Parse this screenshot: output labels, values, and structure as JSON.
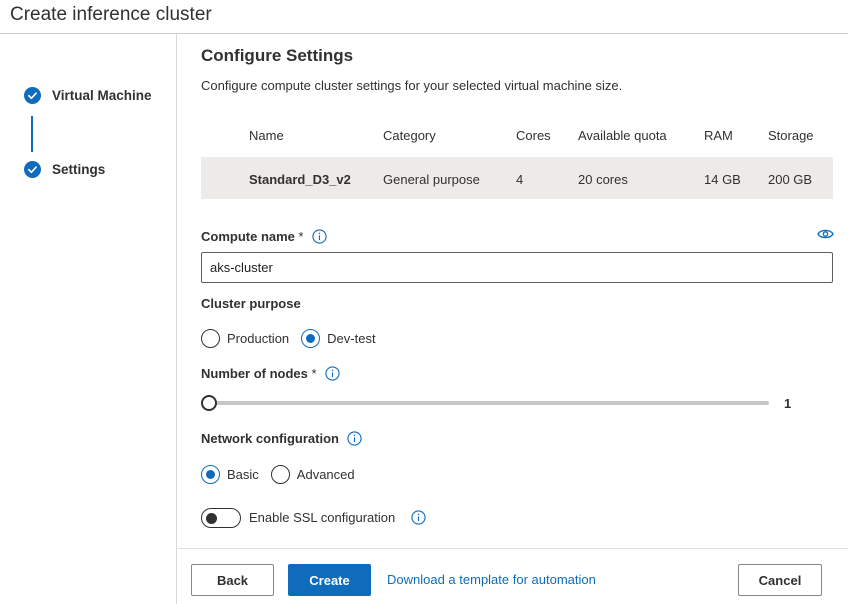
{
  "window": {
    "title": "Create inference cluster"
  },
  "steps": [
    {
      "label": "Virtual Machine",
      "icon": "check-circle-icon",
      "completed": true
    },
    {
      "label": "Settings",
      "icon": "check-circle-icon",
      "completed": true
    }
  ],
  "main": {
    "heading": "Configure Settings",
    "description": "Configure compute cluster settings for your selected virtual machine size."
  },
  "vm_table": {
    "columns": [
      "Name",
      "Category",
      "Cores",
      "Available quota",
      "RAM",
      "Storage"
    ],
    "row": [
      "Standard_D3_v2",
      "General purpose",
      "4",
      "20 cores",
      "14 GB",
      "200 GB"
    ]
  },
  "compute_name": {
    "label": "Compute name",
    "required_marker": "*",
    "value": "aks-cluster",
    "info_icon": "info-icon",
    "eye_icon": "eye-icon"
  },
  "cluster_purpose": {
    "label": "Cluster purpose",
    "options": [
      "Production",
      "Dev-test"
    ],
    "selected": "Dev-test"
  },
  "nodes": {
    "label": "Number of nodes",
    "required_marker": "*",
    "value": "1"
  },
  "network": {
    "label": "Network configuration",
    "options": [
      "Basic",
      "Advanced"
    ],
    "selected": "Basic"
  },
  "ssl": {
    "label": "Enable SSL configuration",
    "enabled": false
  },
  "footer": {
    "back_label": "Back",
    "create_label": "Create",
    "template_link": "Download a template for automation",
    "cancel_label": "Cancel"
  },
  "colors": {
    "accent": "#0f6cbd",
    "selected_row": "#edebe9",
    "text": "#323130"
  }
}
